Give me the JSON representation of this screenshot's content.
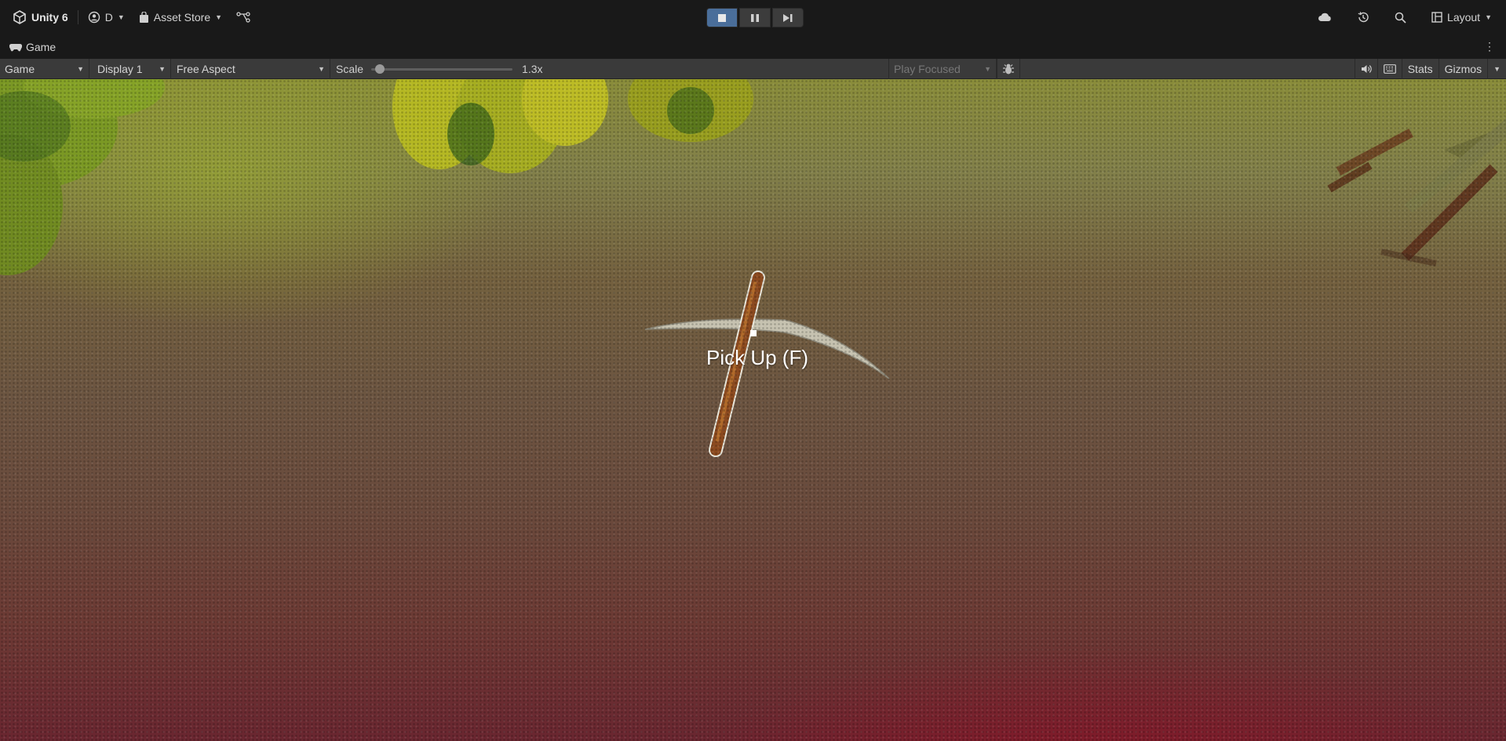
{
  "toolbar": {
    "app_name": "Unity 6",
    "account_label": "D",
    "asset_store_label": "Asset Store",
    "layout_label": "Layout",
    "icons": [
      "unity-logo-icon",
      "account-icon",
      "bag-icon",
      "version-control-icon",
      "play-icon",
      "pause-icon",
      "step-icon",
      "cloud-icon",
      "history-icon",
      "search-icon",
      "layout-icon"
    ]
  },
  "tab": {
    "label": "Game",
    "icon": "gamepad-icon"
  },
  "game_toolbar": {
    "view_mode": "Game",
    "display": "Display 1",
    "aspect": "Free Aspect",
    "scale_label": "Scale",
    "scale_value": "1.3x",
    "scale_level": 0.03,
    "play_mode": "Play Focused",
    "stats_label": "Stats",
    "gizmos_label": "Gizmos"
  },
  "viewport": {
    "interaction_prompt": "Pick Up (F)"
  },
  "colors": {
    "toolbar_bg": "#191919",
    "game_toolbar_bg": "#3a3a3a",
    "play_active": "#4a6e9a",
    "prompt_text": "#ffffff"
  }
}
